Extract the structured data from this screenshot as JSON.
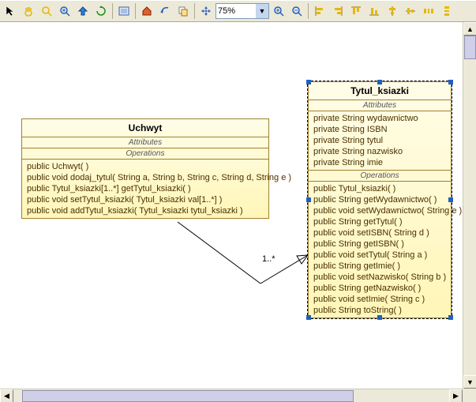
{
  "toolbar": {
    "zoom_value": "75%",
    "icons": {
      "pointer": "pointer-icon",
      "pan": "pan-icon",
      "zoom_area": "zoom-area-icon",
      "zoom_in": "zoom-in-icon",
      "zoom_out": "zoom-out-icon",
      "refresh": "refresh-icon",
      "fit": "fit-icon",
      "home": "home-icon",
      "back": "back-icon",
      "copy": "copy-icon",
      "move": "move-icon",
      "magnify_plus": "magnify-plus-icon",
      "magnify_minus": "magnify-minus-icon",
      "align_left": "align-left-icon",
      "align_right": "align-right-icon",
      "align_top": "align-top-icon",
      "align_bottom": "align-bottom-icon",
      "align_center": "align-center-icon",
      "align_middle": "align-middle-icon",
      "distribute_h": "distribute-h-icon",
      "distribute_v": "distribute-v-icon"
    }
  },
  "diagram": {
    "association_multiplicity": "1..*",
    "classes": [
      {
        "name": "Uchwyt",
        "attributes_header": "Attributes",
        "operations_header": "Operations",
        "attributes": [],
        "operations": [
          "public  Uchwyt(  )",
          "public  void   dodaj_tytul( String a, String b, String c, String d, String e )",
          "public  Tytul_ksiazki[1..*]   getTytul_ksiazki(  )",
          "public  void   setTytul_ksiazki( Tytul_ksiazki val[1..*] )",
          "public  void   addTytul_ksiazki( Tytul_ksiazki tytul_ksiazki )"
        ]
      },
      {
        "name": "Tytul_ksiazki",
        "attributes_header": "Attributes",
        "operations_header": "Operations",
        "attributes": [
          "private  String  wydawnictwo",
          "private  String  ISBN",
          "private  String  tytul",
          "private  String  nazwisko",
          "private  String  imie"
        ],
        "operations": [
          "public  Tytul_ksiazki(  )",
          "public  String   getWydawnictwo(  )",
          "public  void   setWydawnictwo( String e )",
          "public  String   getTytul(  )",
          "public  void   setISBN( String d )",
          "public  String   getISBN(  )",
          "public  void   setTytul( String a )",
          "public  String   getImie(  )",
          "public  void   setNazwisko( String b )",
          "public  String   getNazwisko(  )",
          "public  void   setImie( String c )",
          "public  String   toString(  )"
        ]
      }
    ]
  }
}
